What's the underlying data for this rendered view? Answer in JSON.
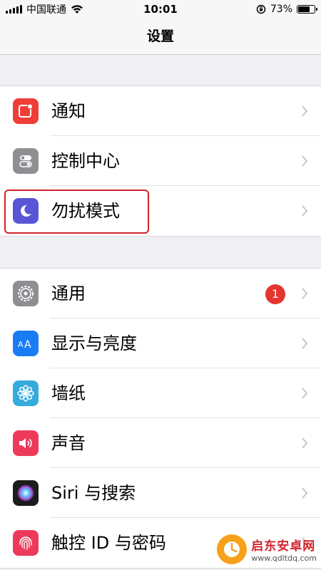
{
  "status_bar": {
    "carrier": "中国联通",
    "time": "10:01",
    "battery_percent": "73%",
    "battery_level": 0.73
  },
  "nav": {
    "title": "设置"
  },
  "group1": [
    {
      "label": "通知",
      "icon": "notifications-icon",
      "color": "#ef3e36"
    },
    {
      "label": "控制中心",
      "icon": "control-center-icon",
      "color": "#8e8e93"
    },
    {
      "label": "勿扰模式",
      "icon": "moon-icon",
      "color": "#5856d6"
    }
  ],
  "group2": [
    {
      "label": "通用",
      "icon": "gear-icon",
      "color": "#8e8e93",
      "badge": "1"
    },
    {
      "label": "显示与亮度",
      "icon": "display-brightness-icon",
      "color": "#1a7cf5"
    },
    {
      "label": "墙纸",
      "icon": "wallpaper-flower-icon",
      "color": "#35aadc"
    },
    {
      "label": "声音",
      "icon": "speaker-icon",
      "color": "#ee3a5a"
    },
    {
      "label": "Siri 与搜索",
      "icon": "siri-icon",
      "color": "#222"
    },
    {
      "label": "触控 ID 与密码",
      "icon": "fingerprint-icon",
      "color": "#ee3a5a"
    }
  ],
  "watermark": {
    "title": "启东安卓网",
    "url": "www.qdltdq.com"
  }
}
